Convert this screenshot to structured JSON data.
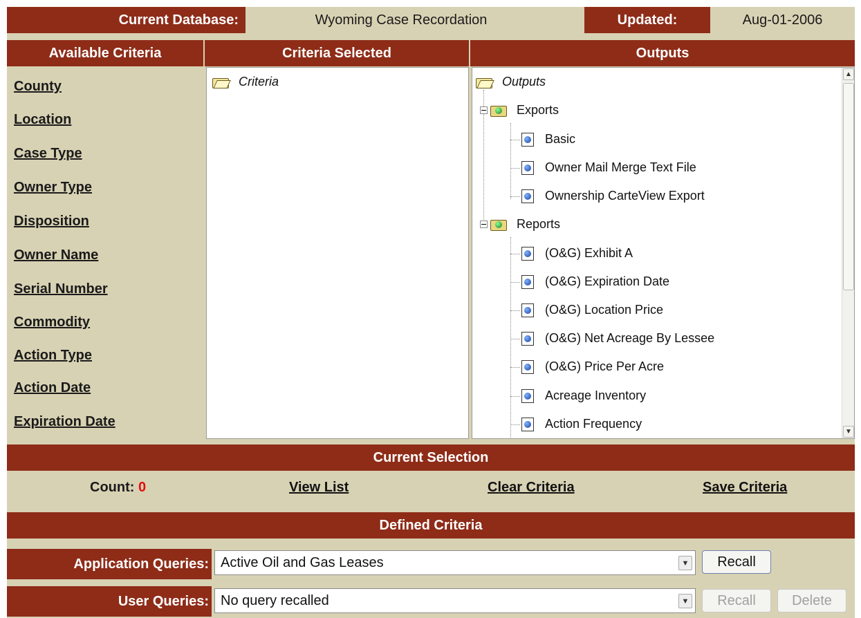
{
  "header": {
    "db_label": "Current Database:",
    "db_value": "Wyoming Case Recordation",
    "updated_label": "Updated:",
    "updated_value": "Aug-01-2006"
  },
  "columns": {
    "available": "Available Criteria",
    "selected": "Criteria Selected",
    "outputs": "Outputs"
  },
  "available_criteria": [
    "County",
    "Location",
    "Case Type",
    "Owner Type",
    "Disposition",
    "Owner Name",
    "Serial Number",
    "Commodity",
    "Action Type",
    "Action Date",
    "Expiration Date"
  ],
  "criteria_tree": {
    "root": "Criteria"
  },
  "outputs_tree": {
    "root": "Outputs",
    "exports": {
      "label": "Exports",
      "items": [
        "Basic",
        "Owner Mail Merge Text File",
        "Ownership CarteView Export"
      ]
    },
    "reports": {
      "label": "Reports",
      "items": [
        "(O&G) Exhibit A",
        "(O&G) Expiration Date",
        "(O&G) Location Price",
        "(O&G) Net Acreage By Lessee",
        "(O&G) Price Per Acre",
        "Acreage Inventory",
        "Action Frequency"
      ]
    }
  },
  "current_selection": {
    "title": "Current Selection",
    "count_label": "Count:",
    "count_value": "0",
    "view_list": "View List",
    "clear_criteria": "Clear Criteria",
    "save_criteria": "Save Criteria"
  },
  "defined_criteria": {
    "title": "Defined Criteria",
    "application_label": "Application Queries:",
    "application_value": "Active Oil and Gas Leases",
    "application_recall": "Recall",
    "user_label": "User Queries:",
    "user_value": "No query recalled",
    "user_recall": "Recall",
    "user_delete": "Delete"
  },
  "colors": {
    "header_bar": "#8e2c18",
    "panel_bg": "#d8d2b4",
    "count_value": "#e01010"
  }
}
